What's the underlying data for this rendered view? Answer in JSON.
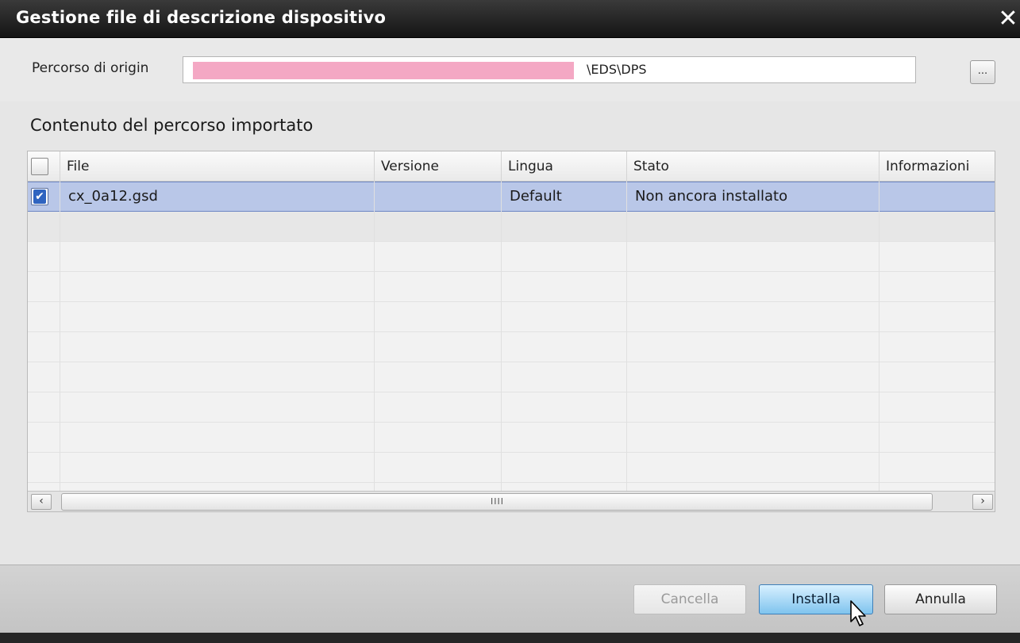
{
  "window": {
    "title": "Gestione file di descrizione dispositivo",
    "close_glyph": "✕"
  },
  "path": {
    "label": "Percorso di origin",
    "value_visible": "\\EDS\\DPS",
    "browse_label": "..."
  },
  "section": {
    "title": "Contenuto del percorso importato"
  },
  "table": {
    "columns": [
      "File",
      "Versione",
      "Lingua",
      "Stato",
      "Informazioni"
    ],
    "rows": [
      {
        "checked": true,
        "file": "cx_0a12.gsd",
        "version": "",
        "language": "Default",
        "status": "Non ancora installato",
        "info": ""
      }
    ]
  },
  "scrollbar": {
    "left_arrow": "‹",
    "right_arrow": "›",
    "grip": "IIII"
  },
  "buttons": {
    "cancel_label": "Cancella",
    "install_label": "Installa",
    "abort_label": "Annulla"
  },
  "colors": {
    "title_bar": "#1e1e1e",
    "selection": "#b9c7e8",
    "primary_button": "#7fc4ee",
    "redaction": "#f4a8c4"
  },
  "icons": [
    "close-icon",
    "browse-icon",
    "checkbox-icon",
    "scroll-left-icon",
    "scroll-right-icon",
    "mouse-cursor-icon"
  ]
}
